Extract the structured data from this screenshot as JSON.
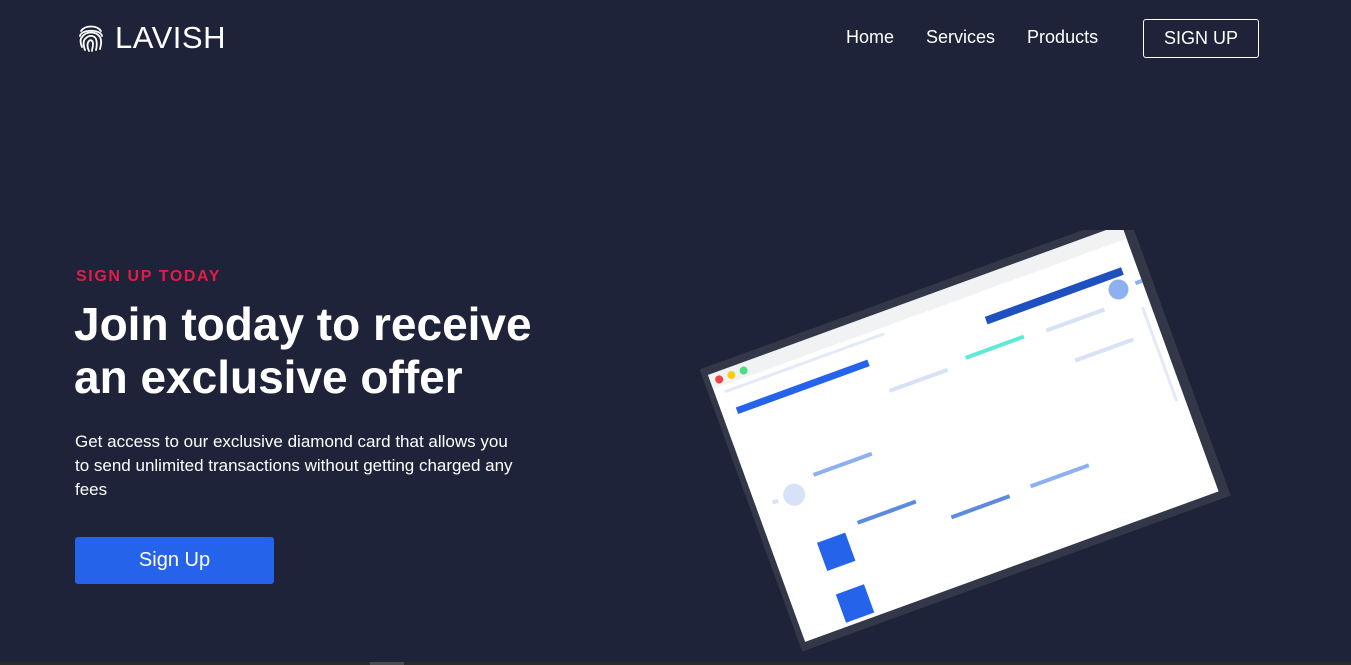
{
  "nav": {
    "brand": "LAVISH",
    "links": [
      "Home",
      "Services",
      "Products"
    ],
    "cta_label": "SIGN UP"
  },
  "hero": {
    "eyebrow": "SIGN UP TODAY",
    "headline_line1": "Join today to receive",
    "headline_line2": "an exclusive offer",
    "subtext": "Get access to our exclusive diamond card that allows you to send unlimited transactions without getting charged any fees",
    "cta_label": "Sign Up"
  },
  "colors": {
    "background": "#1f2339",
    "accent_red": "#e11d48",
    "primary_blue": "#2563eb"
  },
  "icons": {
    "logo": "fingerprint-icon"
  }
}
